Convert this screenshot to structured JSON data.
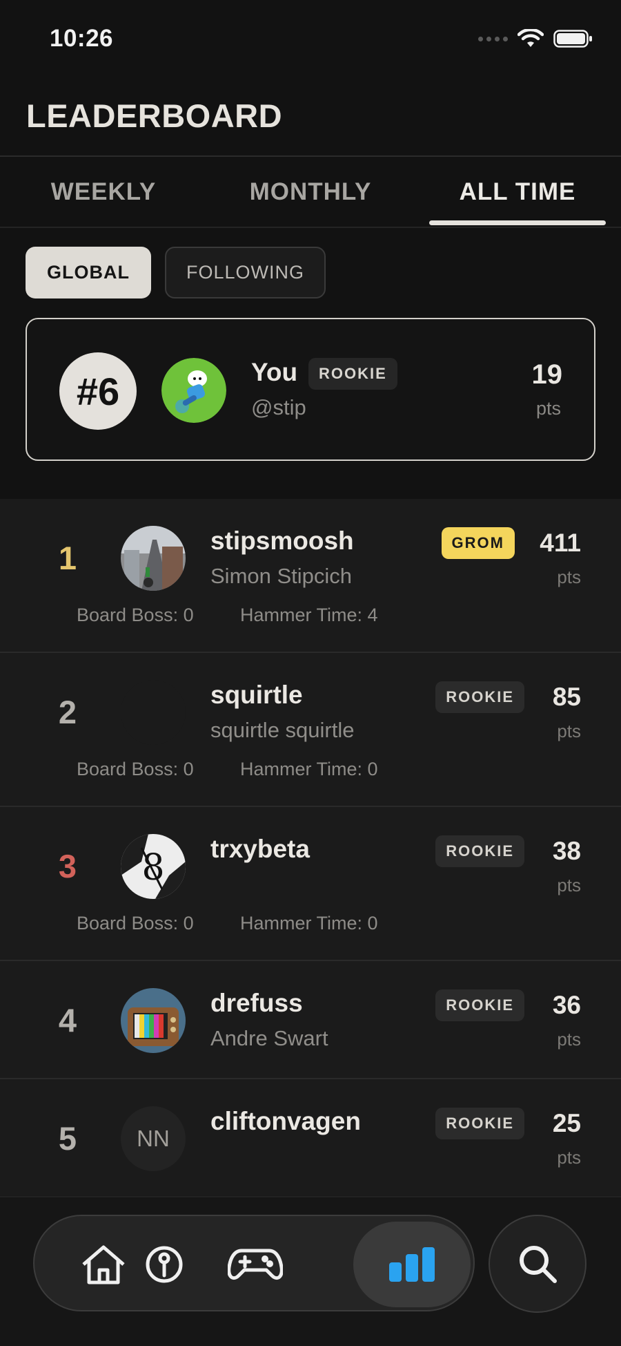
{
  "status_bar": {
    "time": "10:26"
  },
  "header": {
    "title": "LEADERBOARD"
  },
  "tabs": [
    {
      "label": "WEEKLY",
      "active": false
    },
    {
      "label": "MONTHLY",
      "active": false
    },
    {
      "label": "ALL TIME",
      "active": true
    }
  ],
  "filters": {
    "global": "GLOBAL",
    "following": "FOLLOWING",
    "selected": "GLOBAL"
  },
  "me": {
    "rank": "#6",
    "name": "You",
    "badge": "ROOKIE",
    "handle": "@stip",
    "points": "19",
    "points_unit": "pts"
  },
  "rows": [
    {
      "rank": "1",
      "username": "stipsmoosh",
      "fullname": "Simon Stipcich",
      "badge": "GROM",
      "points": "411",
      "unit": "pts",
      "stat1": "Board Boss: 0",
      "stat2": "Hammer Time: 4"
    },
    {
      "rank": "2",
      "username": "squirtle",
      "fullname": "squirtle squirtle",
      "badge": "ROOKIE",
      "points": "85",
      "unit": "pts",
      "stat1": "Board Boss: 0",
      "stat2": "Hammer Time: 0"
    },
    {
      "rank": "3",
      "username": "trxybeta",
      "fullname": "",
      "badge": "ROOKIE",
      "points": "38",
      "unit": "pts",
      "stat1": "Board Boss: 0",
      "stat2": "Hammer Time: 0"
    },
    {
      "rank": "4",
      "username": "drefuss",
      "fullname": "Andre Swart",
      "badge": "ROOKIE",
      "points": "36",
      "unit": "pts"
    },
    {
      "rank": "5",
      "username": "cliftonvagen",
      "fullname": "",
      "badge": "ROOKIE",
      "points": "25",
      "unit": "pts",
      "initials": "NN"
    }
  ],
  "nav": {
    "items": [
      "home-icon",
      "pin-icon",
      "gamepad-icon",
      "leaderboard-icon",
      "search-icon"
    ],
    "active": "leaderboard-icon",
    "accent": "#2aa3f0"
  }
}
